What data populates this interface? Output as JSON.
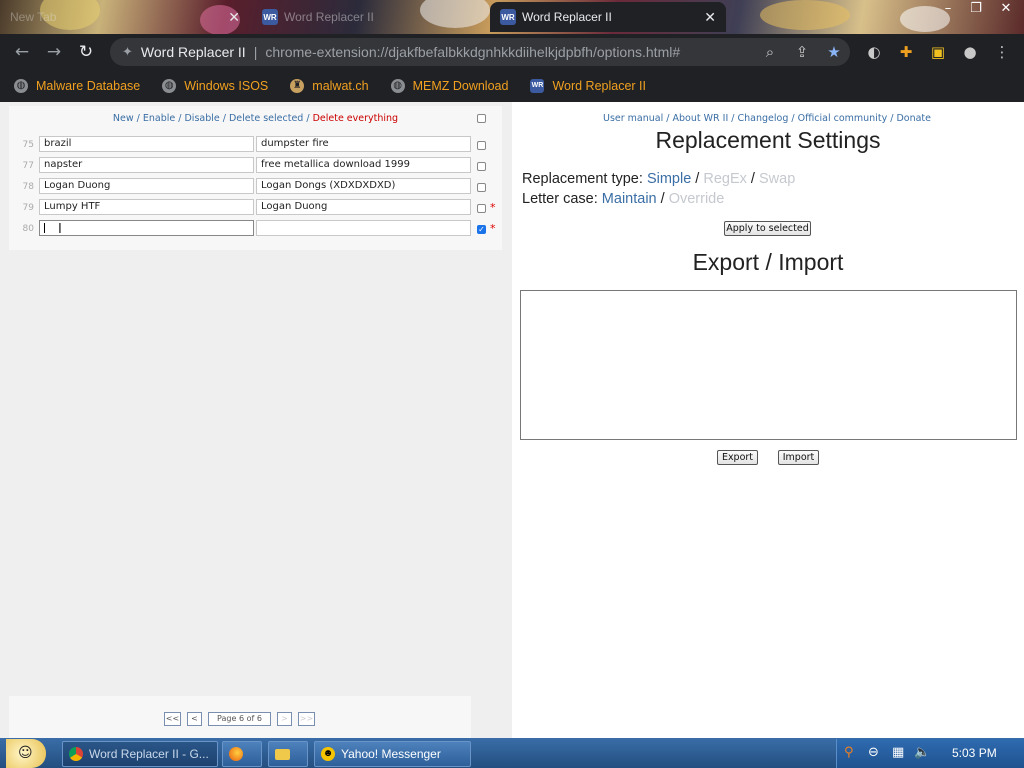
{
  "browser": {
    "tabs": [
      {
        "title": "New Tab",
        "active": false
      },
      {
        "title": "Word Replacer II",
        "active": false
      },
      {
        "title": "Word Replacer II",
        "active": true
      }
    ],
    "favicon_text": "WR",
    "omnibox": {
      "site": "Word Replacer II",
      "separator": "|",
      "url": "chrome-extension://djakfbefalbkkdgnhkkdiihelkjdpbfh/options.html#"
    },
    "bookmarks": [
      {
        "label": "Malware Database",
        "icon": "globe-icon"
      },
      {
        "label": "Windows ISOS",
        "icon": "globe-icon"
      },
      {
        "label": "malwat.ch",
        "icon": "bust-icon"
      },
      {
        "label": "MEMZ Download",
        "icon": "globe-icon"
      },
      {
        "label": "Word Replacer II",
        "icon": "wr-icon"
      }
    ]
  },
  "list_toolbar": {
    "new": "New",
    "enable": "Enable",
    "disable": "Disable",
    "delete_selected": "Delete selected",
    "delete_everything": "Delete everything",
    "sep": " / "
  },
  "rows": [
    {
      "num": "75",
      "find": "brazil",
      "replace": "dumpster fire",
      "checked": false,
      "star": false
    },
    {
      "num": "77",
      "find": "napster",
      "replace": "free metallica download 1999",
      "checked": false,
      "star": false
    },
    {
      "num": "78",
      "find": "Logan Duong",
      "replace": "Logan Dongs (XDXDXDXD)",
      "checked": false,
      "star": false
    },
    {
      "num": "79",
      "find": "Lumpy HTF",
      "replace": "Logan Duong",
      "checked": false,
      "star": true
    },
    {
      "num": "80",
      "find": "",
      "replace": "",
      "checked": true,
      "star": true
    }
  ],
  "star_glyph": "*",
  "pager": {
    "first": "<<",
    "prev": "<",
    "page_label": "Page 6 of 6",
    "next": ">",
    "last": ">>"
  },
  "right_links": {
    "manual": "User manual",
    "about": "About WR II",
    "changelog": "Changelog",
    "community": "Official community",
    "donate": "Donate",
    "sep": " / "
  },
  "settings": {
    "title": "Replacement Settings",
    "type_label": "Replacement type:",
    "type_simple": "Simple",
    "type_regex": "RegEx",
    "type_swap": "Swap",
    "case_label": "Letter case:",
    "case_maintain": "Maintain",
    "case_override": "Override",
    "slash": "/",
    "apply": "Apply to selected"
  },
  "export_import": {
    "title": "Export / Import",
    "text": "",
    "export": "Export",
    "import": "Import"
  },
  "taskbar": {
    "items": [
      {
        "label": "Word Replacer II - G...",
        "icon": "chrome-icon"
      },
      {
        "label": "",
        "icon": "firefox-icon"
      },
      {
        "label": "",
        "icon": "folder-icon"
      },
      {
        "label": "Yahoo! Messenger",
        "icon": "yahoo-icon"
      }
    ],
    "clock": "5:03 PM"
  },
  "colors": {
    "link": "#3a6ea5",
    "danger": "#cc0000",
    "bookmark": "#f0a020",
    "chrome_dark": "#202124"
  }
}
